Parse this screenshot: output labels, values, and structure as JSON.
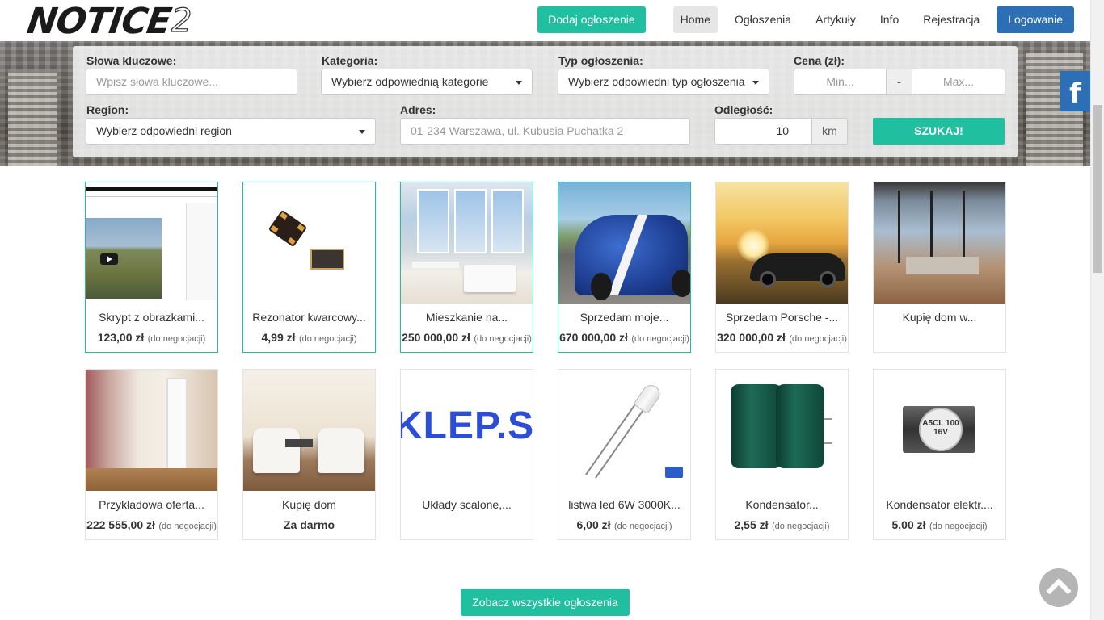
{
  "header": {
    "logo_main": "NOTICE",
    "logo_suffix": "2",
    "add_button": "Dodaj ogłoszenie",
    "nav": [
      "Home",
      "Ogłoszenia",
      "Artykuły",
      "Info",
      "Rejestracja"
    ],
    "login_button": "Logowanie"
  },
  "search": {
    "keywords_label": "Słowa kluczowe:",
    "keywords_placeholder": "Wpisz słowa kluczowe...",
    "category_label": "Kategoria:",
    "category_value": "Wybierz odpowiednią kategorie",
    "type_label": "Typ ogłoszenia:",
    "type_value": "Wybierz odpowiedni typ ogłoszenia",
    "price_label": "Cena (zł):",
    "price_min_placeholder": "Min...",
    "price_sep": "-",
    "price_max_placeholder": "Max...",
    "region_label": "Region:",
    "region_value": "Wybierz odpowiedni region",
    "address_label": "Adres:",
    "address_placeholder": "01-234 Warszawa, ul. Kubusia Puchatka 2",
    "distance_label": "Odległość:",
    "distance_value": "10",
    "distance_unit": "km",
    "search_button": "SZUKAJ!"
  },
  "social": {
    "facebook_glyph": "f"
  },
  "listings": [
    {
      "title": "Skrypt z obrazkami...",
      "price": "123,00 zł",
      "note": "(do negocjacji)",
      "featured": true
    },
    {
      "title": "Rezonator kwarcowy...",
      "price": "4,99 zł",
      "note": "(do negocjacji)",
      "featured": true
    },
    {
      "title": "Mieszkanie na...",
      "price": "250 000,00 zł",
      "note": "(do negocjacji)",
      "featured": true
    },
    {
      "title": "Sprzedam moje...",
      "price": "670 000,00 zł",
      "note": "(do negocjacji)",
      "featured": true
    },
    {
      "title": "Sprzedam Porsche -...",
      "price": "320 000,00 zł",
      "note": "(do negocjacji)",
      "featured": false
    },
    {
      "title": "Kupię dom w...",
      "price": "",
      "note": "",
      "featured": false
    },
    {
      "title": "Przykładowa oferta...",
      "price": "222 555,00 zł",
      "note": "(do negocjacji)",
      "featured": false
    },
    {
      "title": "Kupię dom",
      "price": "Za darmo",
      "note": "",
      "featured": false
    },
    {
      "title": "Układy scalone,...",
      "price": "",
      "note": "",
      "featured": false
    },
    {
      "title": "listwa led 6W 3000K...",
      "price": "6,00 zł",
      "note": "(do negocjacji)",
      "featured": false
    },
    {
      "title": "Kondensator...",
      "price": "2,55 zł",
      "note": "(do negocjacji)",
      "featured": false
    },
    {
      "title": "Kondensator elektr....",
      "price": "5,00 zł",
      "note": "(do negocjacji)",
      "featured": false
    }
  ],
  "images": {
    "shop_text": "KLEP.SA",
    "smd_label": "A5CL 100 16V"
  },
  "footer": {
    "see_all_button": "Zobacz wszystkie ogłoszenia"
  },
  "colors": {
    "accent": "#1fbfa0",
    "primary": "#2d6fb5"
  }
}
